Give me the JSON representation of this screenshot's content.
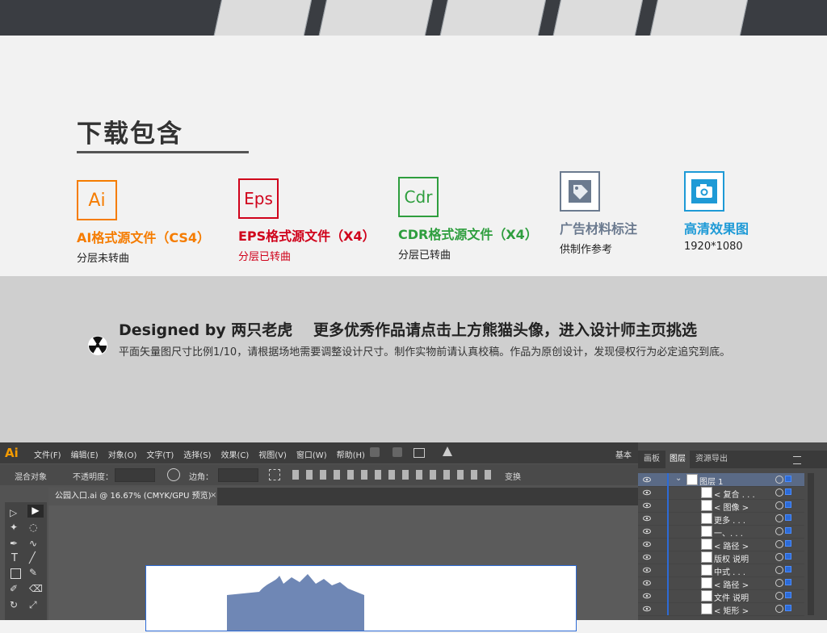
{
  "download": {
    "title": "下载包含",
    "items": [
      {
        "icon_text": "Ai",
        "color": "#f57c00",
        "title": "AI格式源文件（CS4）",
        "sub": "分层未转曲"
      },
      {
        "icon_text": "Eps",
        "color": "#d0021b",
        "title": "EPS格式源文件（X4）",
        "sub": "分层已转曲"
      },
      {
        "icon_text": "Cdr",
        "color": "#2e9e3e",
        "title": "CDR格式源文件（X4）",
        "sub": "分层已转曲"
      },
      {
        "icon": "tag-icon",
        "color": "#6b7a8f",
        "title": "广告材料标注",
        "sub": "供制作参考"
      },
      {
        "icon": "camera-icon",
        "color": "#1e9ad6",
        "title": "高清效果图",
        "sub": "1920*1080"
      }
    ]
  },
  "designer": {
    "designed_by": "Designed by 两只老虎",
    "promo": "更多优秀作品请点击上方熊猫头像，进入设计师主页挑选",
    "notice": "平面矢量图尺寸比例1/10，请根据场地需要调整设计尺寸。制作实物前请认真校稿。作品为原创设计，发现侵权行为必定追究到底。"
  },
  "illustrator": {
    "logo": "Ai",
    "menu": [
      "文件(F)",
      "编辑(E)",
      "对象(O)",
      "文字(T)",
      "选择(S)",
      "效果(C)",
      "视图(V)",
      "窗口(W)",
      "帮助(H)"
    ],
    "workspace": "基本",
    "control": {
      "object_type": "混合对象",
      "opacity_label": "不透明度：",
      "stroke_label": "边角：",
      "transform_label": "变换"
    },
    "document_tab": "公园入口.ai @ 16.67% (CMYK/GPU 预览)",
    "panel_tabs": [
      "画板",
      "图层",
      "资源导出"
    ],
    "layers": [
      "图层 1",
      "< 复合 . . .",
      "< 图像 >",
      "更多 . . .",
      "一、. . .",
      "< 路径 >",
      "版权 说明",
      "中式 . . .",
      "< 路径 >",
      "文件 说明",
      "< 矩形 >"
    ]
  }
}
